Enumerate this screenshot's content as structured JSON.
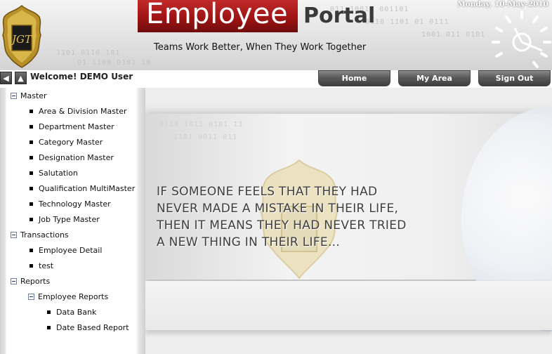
{
  "header": {
    "title_part1": "Employee",
    "title_part2": "Portal",
    "tagline": "Teams Work Better, When They Work Together",
    "date": "Monday, 10-May-2010",
    "logo_icon": "jgt-crest-logo-icon",
    "clock_icon": "clock-icon"
  },
  "topbar": {
    "back_icon": "back-arrow-icon",
    "up_icon": "up-arrow-icon",
    "welcome": "Welcome! DEMO User",
    "tabs": [
      {
        "label": "Home"
      },
      {
        "label": "My Area"
      },
      {
        "label": "Sign Out"
      }
    ]
  },
  "sidebar": {
    "sections": [
      {
        "label": "Master",
        "items": [
          {
            "label": "Area & Division Master"
          },
          {
            "label": "Department Master"
          },
          {
            "label": "Category Master"
          },
          {
            "label": "Designation Master"
          },
          {
            "label": "Salutation"
          },
          {
            "label": "Qualification MultiMaster"
          },
          {
            "label": "Technology Master"
          },
          {
            "label": "Job Type Master"
          }
        ]
      },
      {
        "label": "Transactions",
        "items": [
          {
            "label": "Employee Detail"
          },
          {
            "label": "test"
          }
        ]
      },
      {
        "label": "Reports",
        "subsections": [
          {
            "label": "Employee Reports",
            "items": [
              {
                "label": "Data Bank"
              },
              {
                "label": "Date Based Report"
              }
            ]
          }
        ]
      }
    ]
  },
  "main": {
    "quote_lines": [
      "IF SOMEONE FEELS THAT THEY HAD",
      "NEVER MADE A MISTAKE IN THEIR LIFE,",
      "THEN IT MEANS THEY HAD NEVER TRIED",
      "A NEW THING IN THEIR LIFE..."
    ]
  },
  "colors": {
    "title_red": "#a01414",
    "tab_dark": "#3e3e3e",
    "tree_toggle_blue": "#1a3d7a"
  }
}
